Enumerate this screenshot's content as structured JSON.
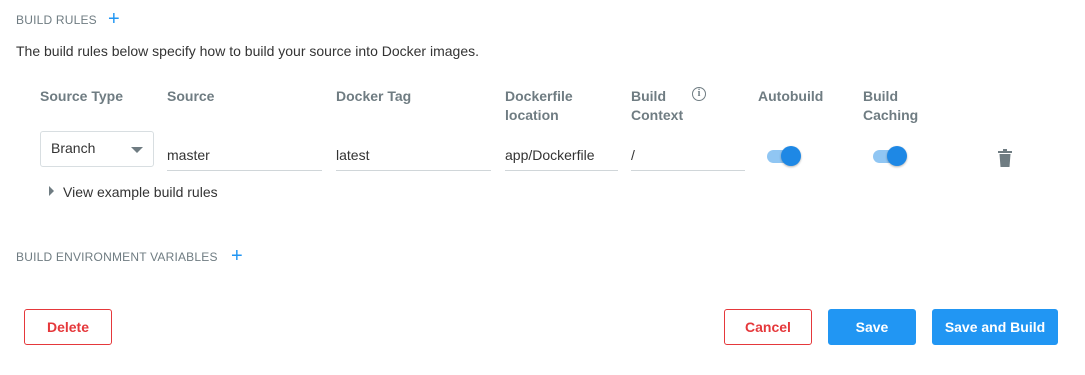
{
  "build_rules": {
    "title": "BUILD RULES",
    "add_symbol": "+",
    "description": "The build rules below specify how to build your source into Docker images.",
    "columns": {
      "source_type": "Source Type",
      "source": "Source",
      "docker_tag": "Docker Tag",
      "dockerfile_location_1": "Dockerfile",
      "dockerfile_location_2": "location",
      "build_context_1": "Build",
      "build_context_2": "Context",
      "autobuild": "Autobuild",
      "build_caching_1": "Build",
      "build_caching_2": "Caching"
    },
    "info_symbol": "i",
    "rule": {
      "source_type": "Branch",
      "source": "master",
      "docker_tag": "latest",
      "dockerfile_location": "app/Dockerfile",
      "build_context": "/",
      "autobuild": true,
      "build_caching": true
    },
    "example_link": "View example build rules"
  },
  "env_vars": {
    "title": "BUILD ENVIRONMENT VARIABLES",
    "add_symbol": "+"
  },
  "footer": {
    "delete": "Delete",
    "cancel": "Cancel",
    "save": "Save",
    "save_and_build": "Save and Build"
  },
  "colors": {
    "accent": "#2196f3",
    "danger": "#e5383b",
    "muted": "#6f7c82"
  }
}
